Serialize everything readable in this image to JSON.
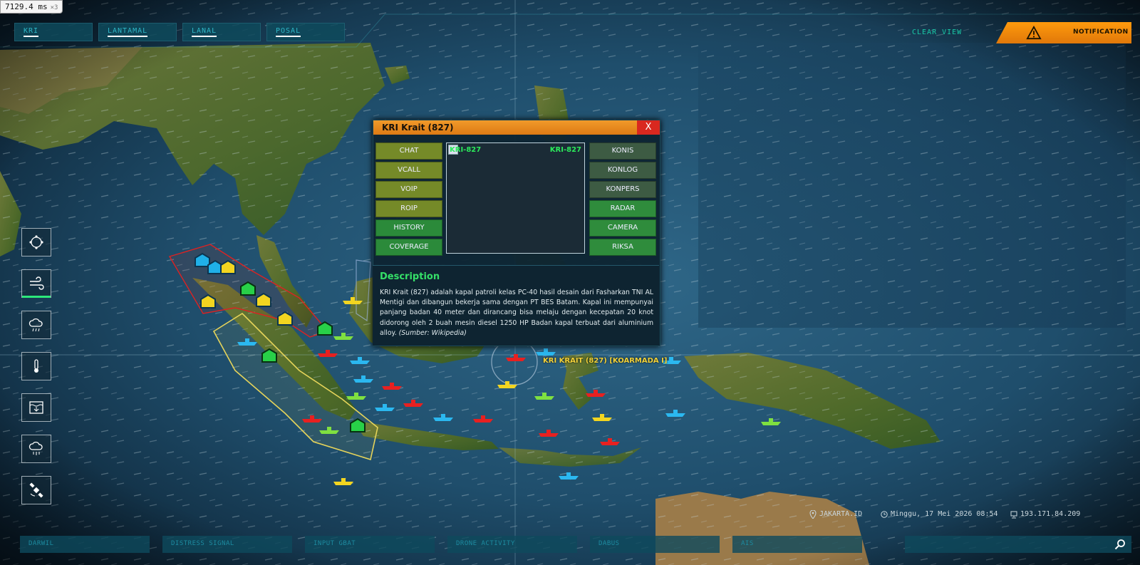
{
  "perf": {
    "ms": "7129.4",
    "unit": "ms",
    "mult": "×3"
  },
  "top_tabs": [
    "KRI",
    "LANTAMAL",
    "LANAL",
    "POSAL"
  ],
  "clear_view": "CLEAR VIEW",
  "notification": "NOTIFICATION",
  "sidebar_icons": [
    "radar-icon",
    "wind-icon",
    "rain-cloud-icon",
    "thermometer-icon",
    "water-level-icon",
    "storm-icon",
    "satellite-icon"
  ],
  "panel": {
    "title": "KRI Krait (827)",
    "close": "X",
    "left_buttons": [
      "CHAT",
      "VCALL",
      "VOIP",
      "ROIP",
      "HISTORY",
      "COVERAGE"
    ],
    "right_buttons": [
      "KONIS",
      "KONLOG",
      "KONPERS",
      "RADAR",
      "CAMERA",
      "RIKSA"
    ],
    "image_alt": "KRI-827",
    "image_id": "KRI-827",
    "desc_title": "Description",
    "desc_text": "KRI Krait (827) adalah kapal patroli kelas PC-40 hasil desain dari Fasharkan TNI AL Mentigi dan dibangun bekerja sama dengan PT BES Batam. Kapal ini mempunyai panjang badan 40 meter dan dirancang bisa melaju dengan kecepatan 20 knot didorong oleh 2 buah mesin diesel 1250 HP Badan kapal terbuat dari aluminium alloy.",
    "desc_source": "(Sumber: Wikipedia)"
  },
  "ship_label": "KRI KRAIT (827) [KOARMADA I]",
  "status": {
    "location": "JAKARTA.ID",
    "datetime": "Minggu, 17 Mei 2026 08:54",
    "ip": "193.171.84.209"
  },
  "bottom_tabs": [
    "DARWIL",
    "DISTRESS SIGNAL",
    "INPUT GBAT",
    "DRONE ACTIVITY",
    "DABUS",
    "AIS"
  ],
  "colors": {
    "accent": "#2fb8c8",
    "notification": "#f59018",
    "close": "#d9281f",
    "desc_title": "#35e068",
    "ship_label": "#f2d23a"
  }
}
